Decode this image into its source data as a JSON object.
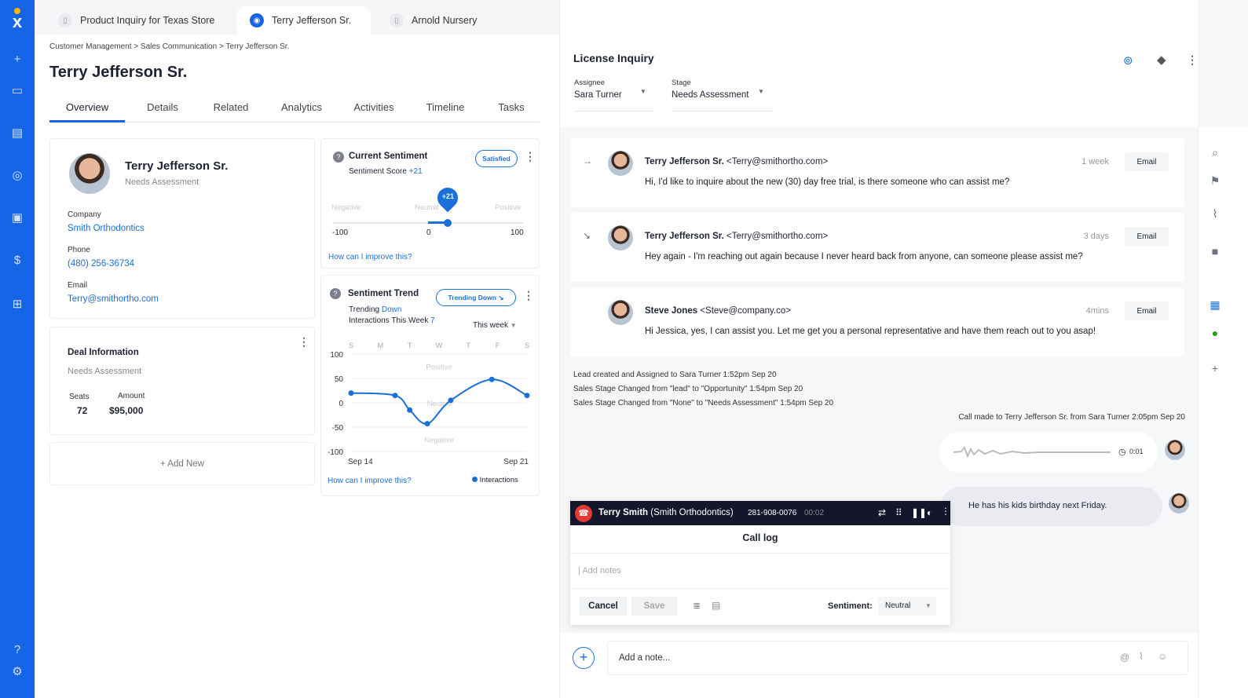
{
  "top_tabs": [
    {
      "label": "Product Inquiry for Texas Store",
      "icon": "document-icon"
    },
    {
      "label": "Terry Jefferson Sr.",
      "icon": "contact-icon",
      "active": true
    },
    {
      "label": "Arnold Nursery",
      "icon": "clipboard-icon"
    }
  ],
  "breadcrumb": [
    "Customer Management",
    "Sales Communication",
    "Terry Jefferson Sr."
  ],
  "breadcrumb_sep": ">",
  "page_title": "Terry Jefferson Sr.",
  "tabs": [
    "Overview",
    "Details",
    "Related",
    "Analytics",
    "Activities",
    "Timeline",
    "Tasks"
  ],
  "contact": {
    "name": "Terry Jefferson Sr.",
    "stage": "Needs Assessment",
    "company_label": "Company",
    "company": "Smith Orthodontics",
    "phone_label": "Phone",
    "phone": "(480) 256-36734",
    "email_label": "Email",
    "email": "Terry@smithortho.com"
  },
  "deal": {
    "title": "Deal Information",
    "stage": "Needs Assessment",
    "seats_label": "Seats",
    "seats": "72",
    "amount_label": "Amount",
    "amount": "$95,000"
  },
  "add_new": "+ Add New",
  "current_sentiment": {
    "title": "Current Sentiment",
    "badge": "Satisfied",
    "score_label": "Sentiment Score",
    "score": "+21",
    "score_value": 21,
    "labels": [
      "Negative",
      "Neutral",
      "Positive"
    ],
    "ticks": [
      "-100",
      "0",
      "100"
    ],
    "improve": "How can I improve this?"
  },
  "sentiment_trend": {
    "title": "Sentiment Trend",
    "badge": "Trending Down",
    "trending_label": "Trending",
    "trending": "Down",
    "interactions_label": "Interactions This Week",
    "interactions": "7",
    "range": "This week",
    "improve": "How can I improve this?"
  },
  "chart_data": {
    "type": "line",
    "days": [
      "S",
      "M",
      "T",
      "W",
      "T",
      "F",
      "S"
    ],
    "x": [
      0,
      1.5,
      2,
      2.6,
      3.4,
      4.8,
      6
    ],
    "values": [
      20,
      15,
      -15,
      -43,
      5,
      48,
      15
    ],
    "ylim": [
      -100,
      100
    ],
    "yticks": [
      "100",
      "50",
      "0",
      "-50",
      "-100"
    ],
    "xlabels": [
      "Sep 14",
      "Sep 21"
    ],
    "bands": [
      "Positive",
      "Neutral",
      "Negative"
    ],
    "series": [
      {
        "name": "Interactions",
        "color": "#1a6fd8"
      }
    ],
    "legend": "bottom-right",
    "grid": true
  },
  "inquiry": {
    "title": "License Inquiry",
    "assignee_label": "Assignee",
    "assignee": "Sara Turner",
    "stage_label": "Stage",
    "stage": "Needs Assessment"
  },
  "messages": [
    {
      "name": "Terry Jefferson Sr.",
      "email": "<Terry@smithortho.com>",
      "time": "1 week",
      "button": "Email",
      "text": "Hi, I'd like to inquire about the new (30) day free trial, is there someone who can assist me?",
      "icon": "arrow-right-icon"
    },
    {
      "name": "Terry Jefferson Sr.",
      "email": "<Terry@smithortho.com>",
      "time": "3 days",
      "button": "Email",
      "text": "Hey again - I'm reaching out again because I never heard back from anyone, can someone please assist me?",
      "icon": "trend-down-icon"
    },
    {
      "name": "Steve Jones",
      "email": "<Steve@company.co>",
      "time": "4mins",
      "button": "Email",
      "text": "Hi Jessica, yes, I can assist you.  Let me get you a personal representative and have them reach out to you asap!"
    }
  ],
  "logs": [
    "Lead created and Assigned to Sara Turner 1:52pm Sep 20",
    "Sales Stage Changed from \"lead\" to \"Opportunity\" 1:54pm Sep 20",
    "Sales Stage Changed from \"None\" to \"Needs Assessment\" 1:54pm Sep 20"
  ],
  "call_made": "Call made to Terry Jefferson Sr. from Sara Turner 2:05pm Sep 20",
  "audio_duration": "0:01",
  "note_bubble": "He has his kids birthday next Friday.",
  "call": {
    "name": "Terry Smith",
    "company": "(Smith Orthodontics)",
    "phone": "281-908-0076",
    "timer": "00:02",
    "title": "Call log",
    "placeholder": "Add notes",
    "cancel": "Cancel",
    "save": "Save",
    "sentiment_label": "Sentiment:",
    "sentiment": "Neutral"
  },
  "composer": {
    "placeholder": "Add a note..."
  },
  "colors": {
    "brand": "#1565e6",
    "accent": "#1a6fd8",
    "call_bar": "#14162b",
    "hangup": "#e53935"
  }
}
